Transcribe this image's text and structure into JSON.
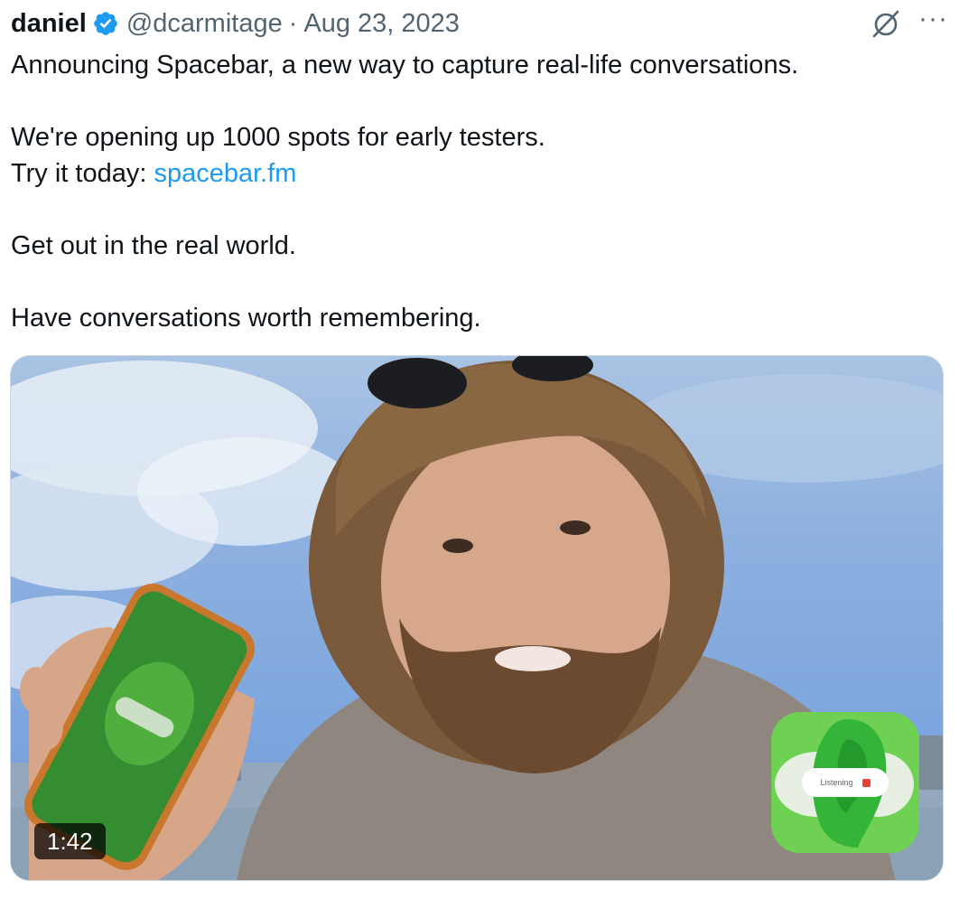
{
  "tweet": {
    "display_name": "daniel",
    "handle": "@dcarmitage",
    "separator": "·",
    "date": "Aug 23, 2023",
    "more_label": "···",
    "lines": {
      "l1": "Announcing Spacebar, a new way to capture real-life conversations.",
      "l2": "We're opening up 1000 spots for early testers.",
      "l3_prefix": "Try it today: ",
      "l3_link": "spacebar.fm",
      "l4": "Get out in the real world.",
      "l5": "Have conversations worth remembering."
    }
  },
  "media": {
    "duration": "1:42",
    "app_pill_text": "Listening"
  },
  "icons": {
    "verified": "verified-badge-icon",
    "grok": "grok-icon",
    "more": "more-options-icon"
  },
  "colors": {
    "verified_blue": "#1d9bf0",
    "link_blue": "#1d9bf0",
    "secondary_text": "#536471",
    "app_icon_green": "#6fd154",
    "record_red": "#e84036"
  }
}
